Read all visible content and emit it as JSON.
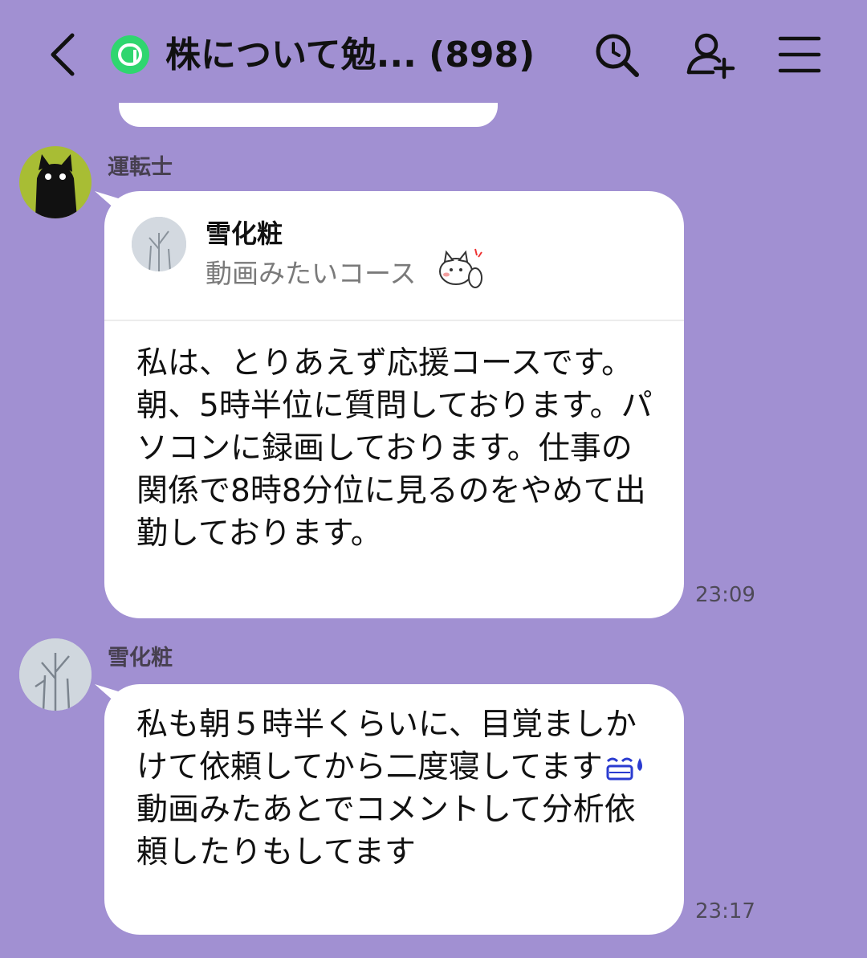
{
  "header": {
    "title": "株について勉... (898)",
    "icons": [
      "chevron-left-icon",
      "openchat-icon",
      "search-icon",
      "add-friend-icon",
      "menu-icon"
    ]
  },
  "messages": [
    {
      "sender": "運転士",
      "avatar": "black-cat-avatar",
      "quote": {
        "name": "雪化粧",
        "text": "動画みたいコース"
      },
      "text": "私は、とりあえず応援コースです。朝、5時半位に質問しております。パソコンに録画しております。仕事の関係で8時8分位に見るのをやめて出勤しております。",
      "time": "23:09"
    },
    {
      "sender": "雪化粧",
      "avatar": "snowy-trees-avatar",
      "text_before_emoji": "私も朝５時半くらいに、目覚ましかけて依頼してから二度寝してます",
      "text_after_emoji": "\n動画みたあとでコメントして分析依頼したりもしてます",
      "time": "23:17"
    }
  ],
  "colors": {
    "background": "#a190d2",
    "openchat_badge": "#2fd66f",
    "bubble": "#ffffff"
  }
}
